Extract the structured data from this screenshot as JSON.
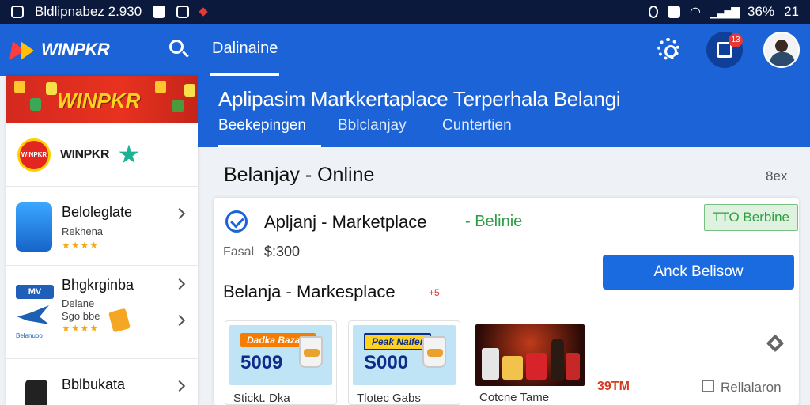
{
  "status_bar": {
    "title": "Bldlipnabez 2.930",
    "battery": "36%",
    "time": "21"
  },
  "appbar": {
    "logo": "WINPKR",
    "tab": "Dalinaine",
    "notif_count": "13"
  },
  "left_panel": {
    "banner_text": "WINPKR",
    "brand": {
      "logo_text": "WINPKR",
      "name": "WINPKR"
    },
    "items": [
      {
        "title": "Beloleglate",
        "sub": "Rekhena",
        "stars": "★★★★"
      },
      {
        "title": "Bhgkrginba",
        "sub": "Delane",
        "sub2": "Sgo bbe",
        "stars": "★★★★",
        "tag": "MV",
        "tag2": "Belanuoo"
      },
      {
        "title": "Bblbukata"
      }
    ]
  },
  "main": {
    "title": "Aplipasim Markkertaplace Terperhala Belangi",
    "tabs": [
      "Beekepingen",
      "Bblclanjay",
      "Cuntertien"
    ],
    "section_title": "Belanjay - Online",
    "section_aside": "8ex",
    "card": {
      "title": "Apljanj - Marketplace",
      "status": "- Belinie",
      "badge": "TTO Berbine",
      "price_label": "Fasal",
      "price_value": "$:300",
      "action": "Anck Belisow",
      "sub_title": "Belanja - Markesplace",
      "sub_icon": "+5"
    },
    "products": [
      {
        "tag": "Dadka Bazaar",
        "number": "5009",
        "label": "Stickt. Dka"
      },
      {
        "tag": "Peak Naifer",
        "number": "S000",
        "label": "Tlotec Gabs"
      },
      {
        "label": "Cotcne Tame"
      }
    ],
    "price_tag": "39TM",
    "detail_link": "Rellalaron"
  },
  "colors": {
    "primary": "#1b63d6",
    "status_bar": "#0b1a3c",
    "success": "#2e9e45",
    "accent_red": "#e53935"
  }
}
